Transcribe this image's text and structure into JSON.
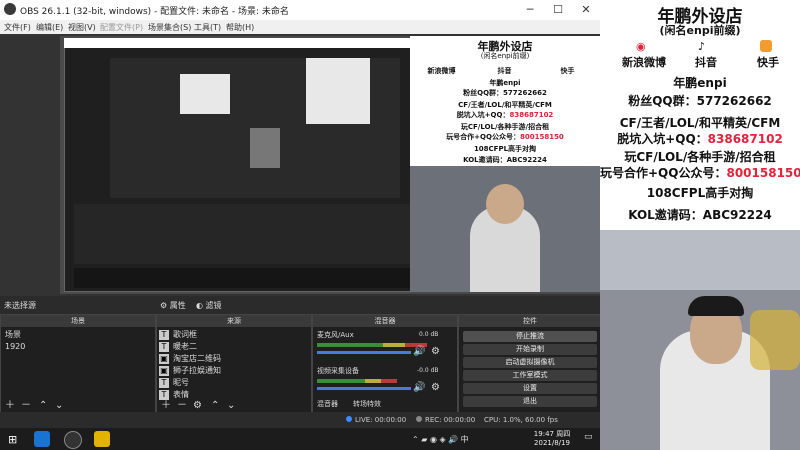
{
  "window": {
    "title": "OBS 26.1.1 (32-bit, windows) - 配置文件: 未命名 - 场景: 未命名",
    "minimize": "─",
    "maximize": "☐",
    "close": "✕"
  },
  "menu": [
    "文件(F)",
    "编辑(E)",
    "视图(V)",
    "配置文件(P)",
    "场景集合(S)",
    "工具(T)",
    "帮助(H)"
  ],
  "preview_overlay": {
    "title": "年鹏外设店",
    "subtitle": "(闲名enpi前缀)",
    "social": [
      "新浪微博",
      "抖音",
      "快手"
    ],
    "name": "年鹏enpi",
    "fans_qq": "粉丝QQ群：577262662",
    "line1": "CF/王者/LOL/和平精英/CFM",
    "line2a": "脱坑入坑+QQ：",
    "line2b": "838687102",
    "line3": "玩CF/LOL/各种手游/招合租",
    "line4a": "玩号合作+QQ公众号：",
    "line4b": "800158150",
    "line5": "108CFPL高手对掏",
    "line6": "KOL邀请码：ABC92224"
  },
  "source_bar": {
    "no_source": "未选择源",
    "properties": "属性",
    "filters": "滤镜"
  },
  "scenes": {
    "header": "场景",
    "items": [
      "场景",
      "1920"
    ]
  },
  "sources": {
    "header": "来源",
    "items": [
      "歌词框",
      "暖老二",
      "淘宝店二维码",
      "狮子拉娱通知",
      "昵号",
      "表情"
    ]
  },
  "mixer": {
    "header": "混音器",
    "channel1": "麦克风/Aux",
    "channel1_db": "0.0 dB",
    "channel2": "视频采集设备",
    "channel2_db": "-0.0 dB",
    "tab_mixer": "混音器",
    "tab_transitions": "转场特效"
  },
  "controls": {
    "header": "控件",
    "buttons": [
      "停止推流",
      "开始录制",
      "启动虚拟摄像机",
      "工作室模式",
      "设置",
      "退出"
    ]
  },
  "status": {
    "live": "LIVE: 00:00:00",
    "rec": "REC: 00:00:00",
    "cpu": "CPU: 1.0%, 60.00 fps"
  },
  "taskbar": {
    "time": "19:47 周四",
    "date": "2021/8/19"
  },
  "promo": {
    "title": "年鹏外设店",
    "subtitle": "(闲名enpi前缀)",
    "social": [
      "新浪微博",
      "抖音",
      "快手"
    ],
    "name": "年鹏enpi",
    "fans_qq": "粉丝QQ群：577262662",
    "line1": "CF/王者/LOL/和平精英/CFM",
    "line2a": "脱坑入坑+QQ：",
    "line2b": "838687102",
    "line3": "玩CF/LOL/各种手游/招合租",
    "line4a": "玩号合作+QQ公众号：",
    "line4b": "800158150",
    "line5": "108CFPL高手对掏",
    "line6": "KOL邀请码：ABC92224"
  },
  "colors": {
    "accent_red": "#e8203a",
    "obs_dark": "#2b2b2b",
    "meter_green": "#3a8d3a"
  }
}
